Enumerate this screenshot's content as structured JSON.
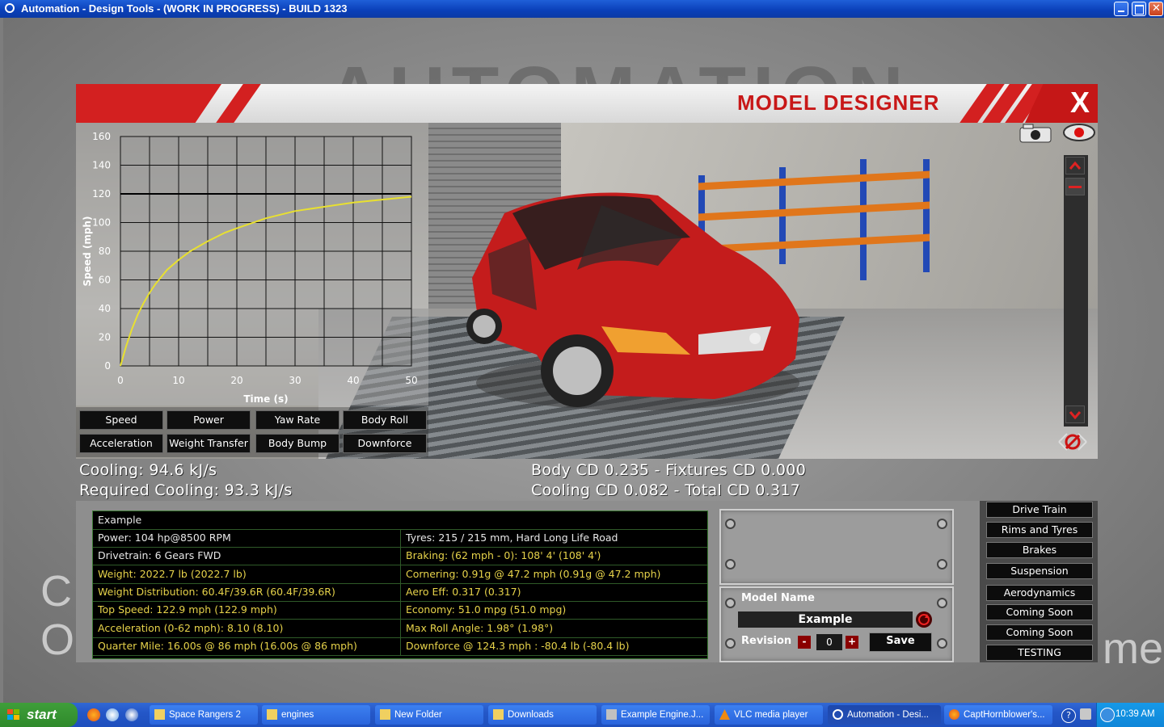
{
  "window": {
    "title": "Automation - Design Tools - (WORK IN PROGRESS) - BUILD 1323"
  },
  "background": {
    "logo_text": "AUTOMATION",
    "left_letters": [
      "C",
      "O"
    ],
    "right_letters": "me"
  },
  "designer": {
    "title": "MODEL DESIGNER",
    "close_label": "X"
  },
  "graph": {
    "ylabel": "Speed (mph)",
    "xlabel": "Time (s)",
    "buttons_row1": [
      "Speed",
      "Power",
      "Yaw Rate",
      "Body Roll"
    ],
    "buttons_row2": [
      "Acceleration",
      "Weight Transfer",
      "Body Bump",
      "Downforce"
    ]
  },
  "chart_data": {
    "type": "line",
    "xlabel": "Time (s)",
    "ylabel": "Speed (mph)",
    "xlim": [
      0,
      50
    ],
    "ylim": [
      0,
      160
    ],
    "xticks": [
      0,
      10,
      20,
      30,
      40,
      50
    ],
    "yticks": [
      0,
      20,
      40,
      60,
      80,
      100,
      120,
      140,
      160
    ],
    "grid": true,
    "reference_line_y": 120,
    "series": [
      {
        "color": "#e8e030",
        "x": [
          0,
          1,
          2,
          3,
          4,
          5,
          6,
          8,
          10,
          12,
          15,
          18,
          20,
          25,
          30,
          35,
          40,
          45,
          50
        ],
        "y": [
          0,
          14,
          26,
          36,
          44,
          51,
          57,
          67,
          74,
          80,
          87,
          93,
          96,
          103,
          108,
          111,
          114,
          116,
          118
        ]
      }
    ]
  },
  "cooling": {
    "line1": "Cooling: 94.6 kJ/s",
    "line2": "Required Cooling: 93.3 kJ/s"
  },
  "drag": {
    "line1": "Body CD 0.235 - Fixtures CD 0.000",
    "line2": "Cooling CD 0.082 - Total CD 0.317"
  },
  "stats": {
    "name": "Example",
    "rows": [
      {
        "left": "Power: 104 hp@8500 RPM",
        "left_color": "white",
        "right": "Tyres: 215 / 215 mm, Hard Long Life Road",
        "right_color": "white"
      },
      {
        "left": "Drivetrain: 6 Gears FWD",
        "left_color": "white",
        "right": "Braking: (62 mph - 0): 108' 4' (108' 4')",
        "right_color": "yellow"
      },
      {
        "left": "Weight: 2022.7 lb (2022.7 lb)",
        "left_color": "yellow",
        "right": "Cornering: 0.91g @ 47.2 mph (0.91g @ 47.2 mph)",
        "right_color": "yellow"
      },
      {
        "left": "Weight Distribution: 60.4F/39.6R (60.4F/39.6R)",
        "left_color": "yellow",
        "right": "Aero Eff: 0.317 (0.317)",
        "right_color": "yellow"
      },
      {
        "left": "Top Speed: 122.9 mph (122.9 mph)",
        "left_color": "yellow",
        "right": "Economy: 51.0 mpg (51.0 mpg)",
        "right_color": "yellow"
      },
      {
        "left": "Acceleration (0-62 mph): 8.10 (8.10)",
        "left_color": "yellow",
        "right": "Max Roll Angle: 1.98° (1.98°)",
        "right_color": "yellow"
      },
      {
        "left": "Quarter Mile: 16.00s @ 86 mph (16.00s @ 86 mph)",
        "left_color": "yellow",
        "right": "Downforce @ 124.3 mph : -80.4 lb (-80.4 lb)",
        "right_color": "yellow"
      }
    ]
  },
  "model": {
    "name_label": "Model Name",
    "name_value": "Example",
    "revision_label": "Revision",
    "revision_minus": "-",
    "revision_value": "0",
    "revision_plus": "+",
    "save_label": "Save"
  },
  "side_menu": [
    "Drive Train",
    "Rims and Tyres",
    "Brakes",
    "Suspension",
    "Aerodynamics",
    "Coming Soon",
    "Coming Soon",
    "TESTING"
  ],
  "taskbar": {
    "start_label": "start",
    "tasks": [
      "Space Rangers 2",
      "engines",
      "New Folder",
      "Downloads",
      "Example Engine.J...",
      "VLC media player",
      "Automation - Desi...",
      "CaptHornblower's..."
    ],
    "active_task": "Automation - Desi...",
    "clock": "10:39 AM"
  },
  "colors": {
    "accent_red": "#c81818",
    "stat_yellow": "#e6d24a",
    "curve_yellow": "#e8e030",
    "xp_blue": "#2457c8",
    "start_green": "#3f9e3a"
  }
}
